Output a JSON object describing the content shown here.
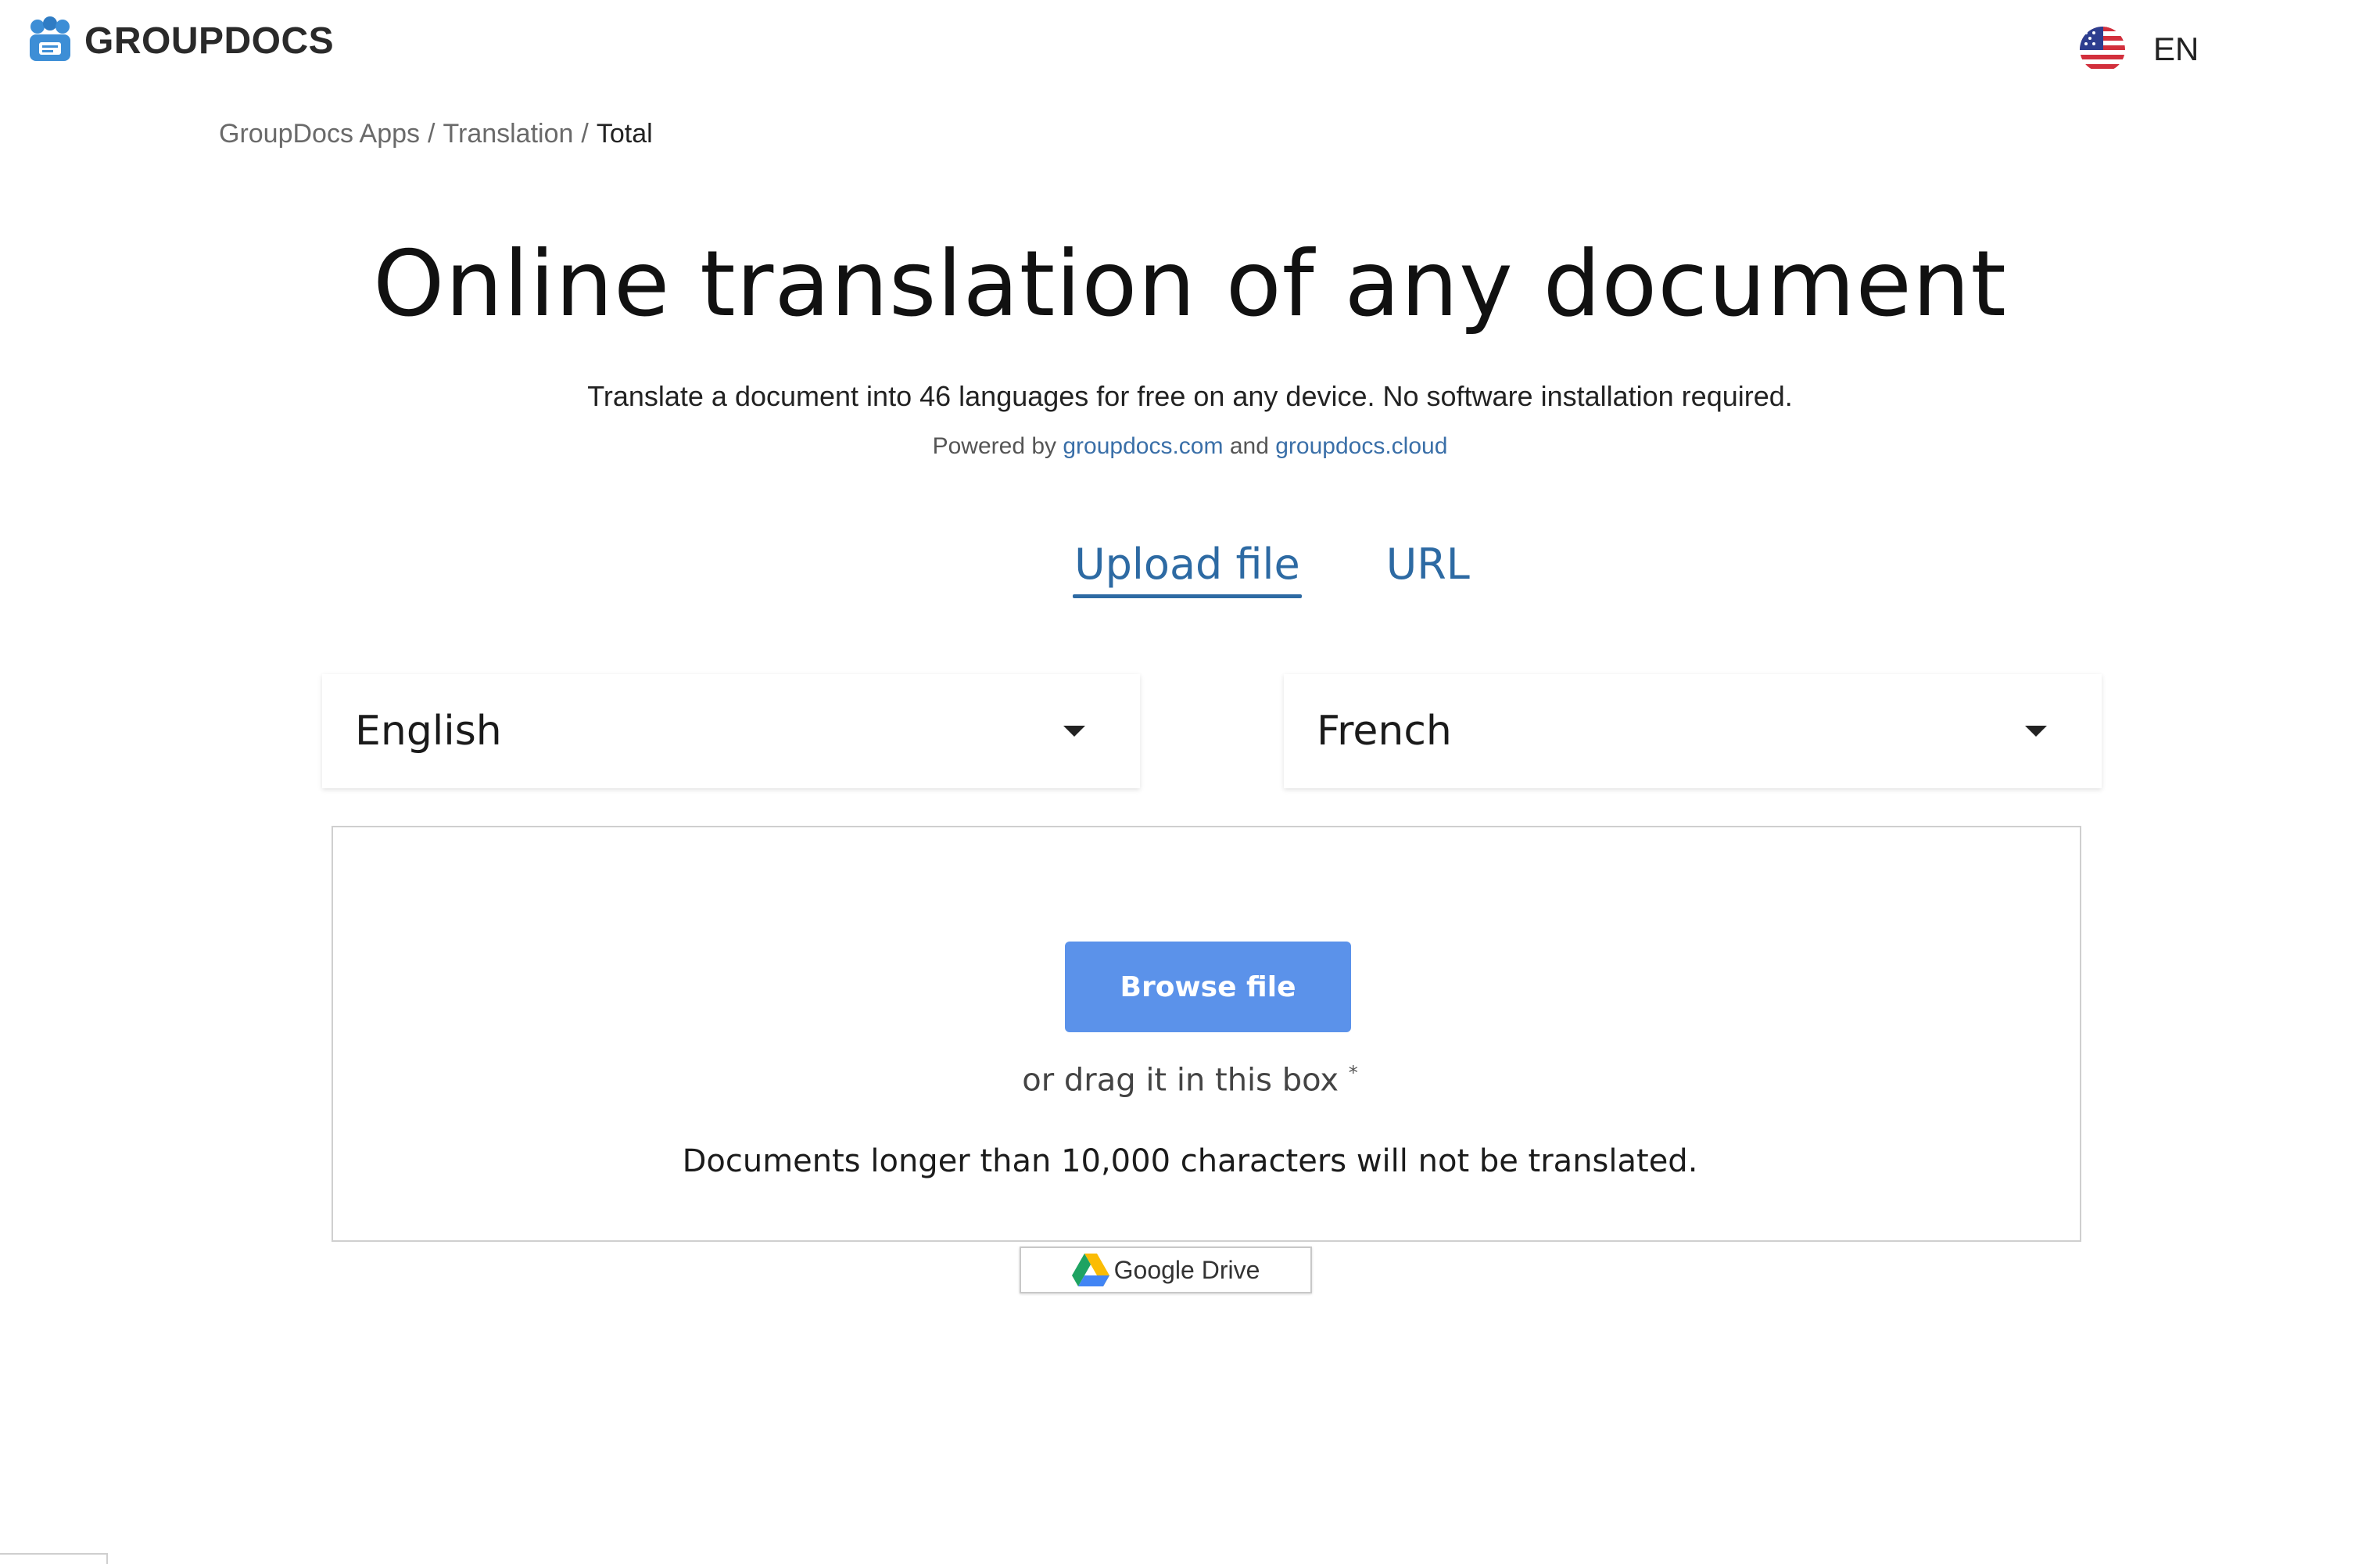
{
  "header": {
    "logo_text": "GROUPDOCS",
    "language_code": "EN",
    "flag_icon": "us-flag-icon"
  },
  "breadcrumb": {
    "items": [
      "GroupDocs Apps",
      "Translation",
      "Total"
    ],
    "separator": "/"
  },
  "hero": {
    "title": "Online translation of any document",
    "subtitle": "Translate a document into 46 languages for free on any device. No software installation required.",
    "powered_prefix": "Powered by",
    "powered_link1": "groupdocs.com",
    "powered_and": "and",
    "powered_link2": "groupdocs.cloud"
  },
  "tabs": [
    {
      "label": "Upload file",
      "active": true
    },
    {
      "label": "URL",
      "active": false
    }
  ],
  "language_selects": {
    "source": "English",
    "target": "French"
  },
  "dropzone": {
    "browse_label": "Browse file",
    "drag_text": "or drag it in this box",
    "drag_marker": "*",
    "limit_text": "Documents longer than 10,000 characters will not be translated."
  },
  "google_drive": {
    "label": "Google Drive",
    "icon": "google-drive-icon"
  },
  "colors": {
    "accent": "#2d6aa3",
    "button": "#5b92ea",
    "logo": "#2a2a2a"
  }
}
